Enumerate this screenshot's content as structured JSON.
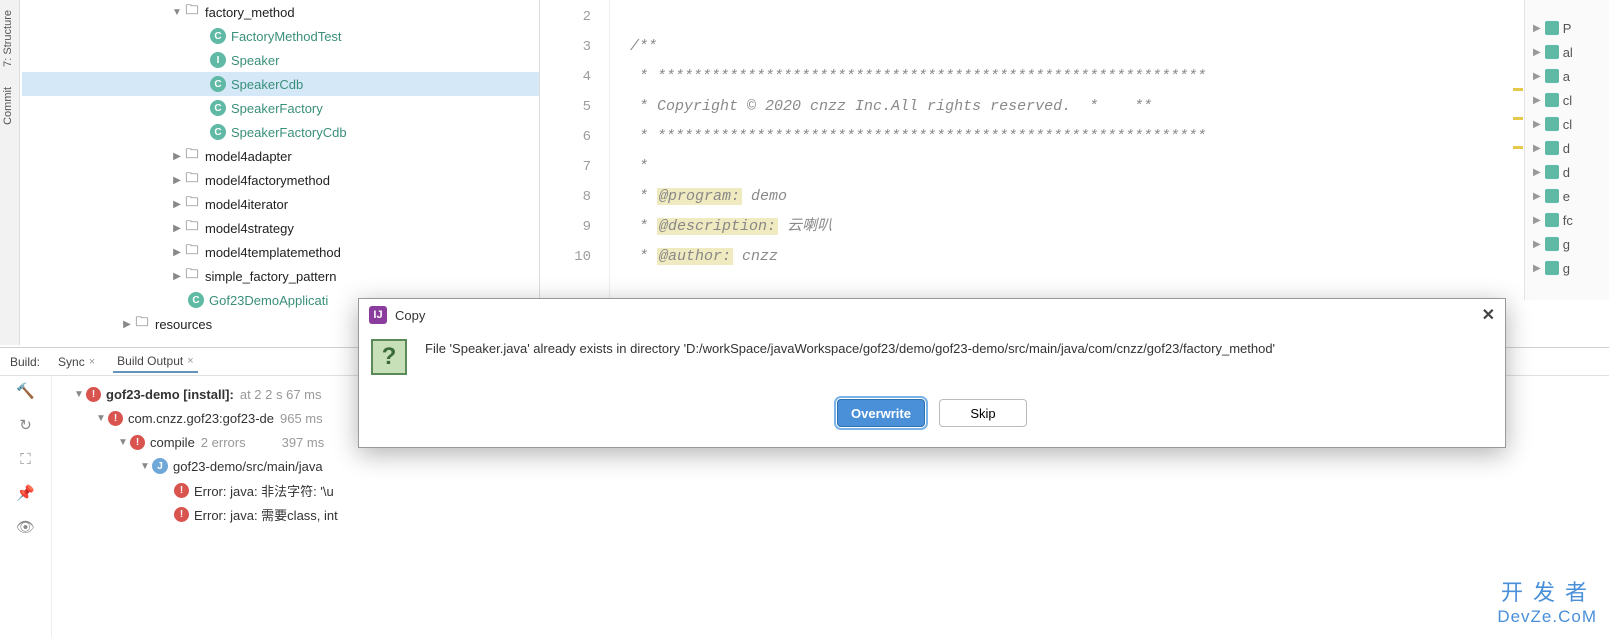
{
  "leftTabs": {
    "structure": "7: Structure",
    "commit": "Commit"
  },
  "tree": {
    "root": {
      "label": "factory_method"
    },
    "children": [
      {
        "icon": "cteal",
        "label": "FactoryMethodTest"
      },
      {
        "icon": "i",
        "label": "Speaker"
      },
      {
        "icon": "cteal",
        "label": "SpeakerCdb",
        "selected": true
      },
      {
        "icon": "cteal",
        "label": "SpeakerFactory"
      },
      {
        "icon": "cteal",
        "label": "SpeakerFactoryCdb"
      }
    ],
    "siblings": [
      "model4adapter",
      "model4factorymethod",
      "model4iterator",
      "model4strategy",
      "model4templatemethod",
      "simple_factory_pattern"
    ],
    "app": "Gof23DemoApplicati",
    "resources": "resources"
  },
  "editor": {
    "lineStart": 2,
    "lines": [
      "",
      "/**",
      " * *************************************************************",
      " * Copyright © 2020 cnzz Inc.All rights reserved.  *    **",
      " * *************************************************************",
      " *",
      " * @program: demo",
      " * @description: 云喇叭",
      " * @author: cnzz"
    ],
    "tags": {
      "program": "@program:",
      "programVal": "demo",
      "desc": "@description:",
      "descVal": "云喇叭",
      "author": "@author:",
      "authorVal": "cnzz"
    }
  },
  "rightPanel": [
    "P",
    "al",
    "a",
    "cl",
    "cl",
    "d",
    "d",
    "e",
    "fc",
    "g",
    "g"
  ],
  "build": {
    "label": "Build:",
    "tabs": {
      "sync": "Sync",
      "output": "Build Output"
    },
    "rows": {
      "root": "gof23-demo [install]:",
      "rootMeta": "at 2 2 s 67 ms",
      "mod": "com.cnzz.gof23:gof23-de",
      "modMeta": "965 ms",
      "compile": "compile",
      "compileMeta": "2 errors",
      "compileTime": "397 ms",
      "path": "gof23-demo/src/main/java",
      "err1": "Error: java: 非法字符: '\\u",
      "err2": "Error: java: 需要class, int"
    }
  },
  "dialog": {
    "title": "Copy",
    "message": "File 'Speaker.java' already exists in directory 'D:/workSpace/javaWorkspace/gof23/demo/gof23-demo/src/main/java/com/cnzz/gof23/factory_method'",
    "overwrite": "Overwrite",
    "skip": "Skip"
  },
  "watermark": {
    "line1": "开发者",
    "line2": "DevZe.CoM"
  }
}
